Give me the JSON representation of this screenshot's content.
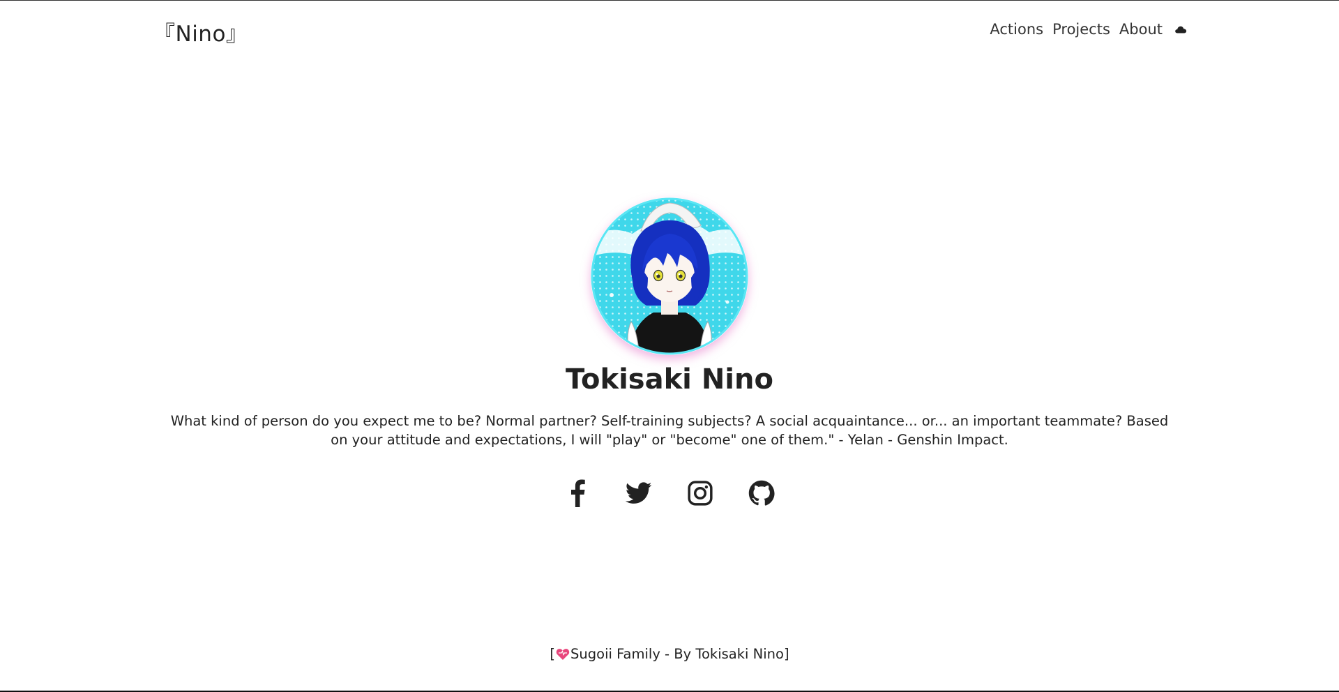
{
  "header": {
    "brand": "『Nino』",
    "nav": [
      {
        "label": "Actions"
      },
      {
        "label": "Projects"
      },
      {
        "label": "About"
      }
    ],
    "theme_toggle_icon": "cloud-icon"
  },
  "profile": {
    "avatar_icon": "avatar-anime-maid",
    "name": "Tokisaki Nino",
    "quote": "What kind of person do you expect me to be? Normal partner? Self-training subjects? A social acquaintance... or... an important teammate? Based on your attitude and expectations, I will \"play\" or \"become\" one of them.\" - Yelan - Genshin Impact."
  },
  "social": [
    {
      "icon": "facebook-icon"
    },
    {
      "icon": "twitter-icon"
    },
    {
      "icon": "instagram-icon"
    },
    {
      "icon": "github-icon"
    }
  ],
  "footer": {
    "open_bracket": "[",
    "text": "Sugoii Family - By Tokisaki Nino",
    "close_bracket": "]",
    "heart_icon": "heart-icon"
  },
  "colors": {
    "text": "#222222",
    "avatar_bg": "#3fd7ea",
    "hair": "#1530c0",
    "glow": "#e678c8",
    "heart": "#e8467c"
  }
}
